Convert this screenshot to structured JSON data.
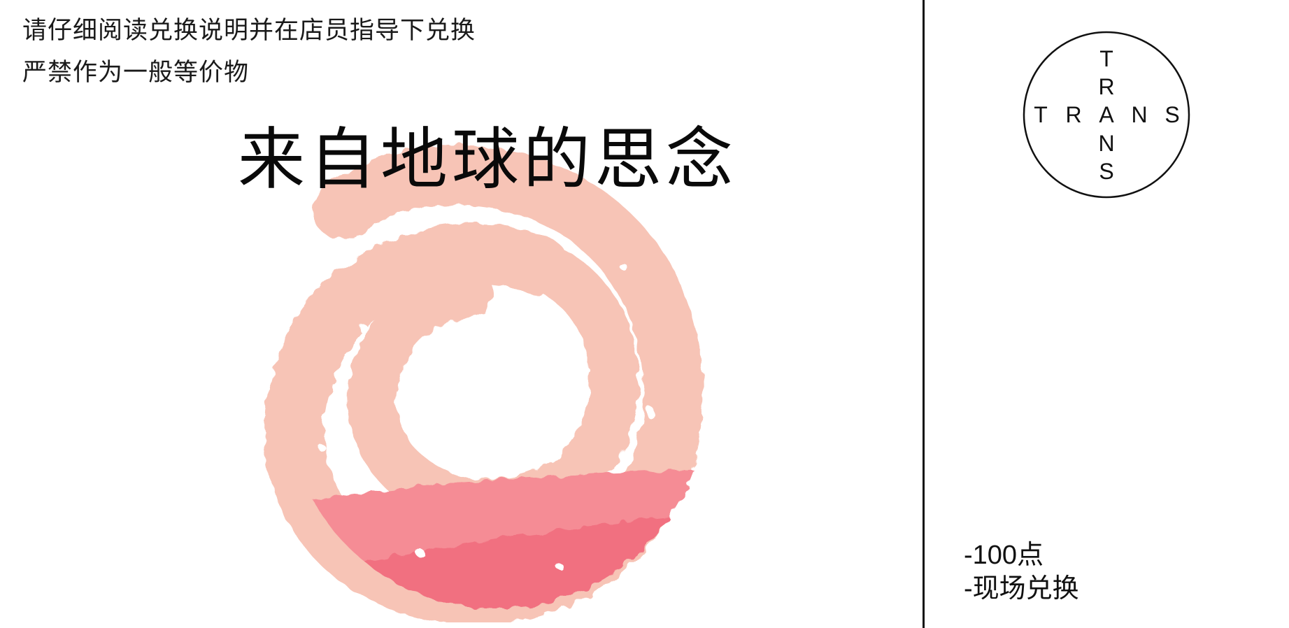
{
  "notice": {
    "line1": "请仔细阅读兑换说明并在店员指导下兑换",
    "line2": "严禁作为一般等价物"
  },
  "title": "来自地球的思念",
  "logo": {
    "letters_horizontal": [
      "T",
      "R",
      "A",
      "N",
      "S"
    ],
    "letters_vertical": [
      "T",
      "R",
      "A",
      "N",
      "S"
    ]
  },
  "terms": {
    "points": "-100点",
    "redeem": "-现场兑换"
  },
  "colors": {
    "swirl_light": "#f7c4b6",
    "swirl_band": "#f58c95",
    "swirl_band_dark": "#f06a7c",
    "divider": "#111111"
  }
}
